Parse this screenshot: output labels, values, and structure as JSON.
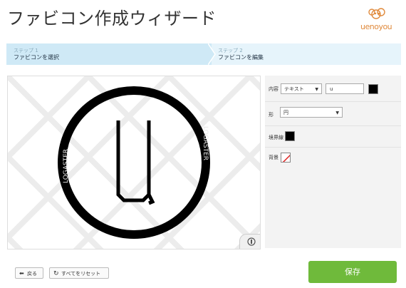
{
  "header": {
    "title": "ファビコン作成ウィザード",
    "logo_text": "uenoyou"
  },
  "steps": [
    {
      "number": "ステップ 1",
      "label": "ファビコンを選択"
    },
    {
      "number": "ステップ 2",
      "label": "ファビコンを編集"
    }
  ],
  "preview": {
    "glyph": "u",
    "watermark": "LOGASTER",
    "zoom_label": "®"
  },
  "settings": {
    "content_label": "内容",
    "content_type": "テキスト",
    "content_value": "u",
    "shape_label": "形",
    "shape_value": "円",
    "border_label": "境界線",
    "background_label": "背景"
  },
  "footer": {
    "back_label": "戻る",
    "reset_label": "すべてをリセット",
    "save_label": "保存"
  },
  "colors": {
    "accent_green": "#6fba3b",
    "step_active_bg": "#cfe9f6",
    "step_bg": "#e6f4fb"
  }
}
